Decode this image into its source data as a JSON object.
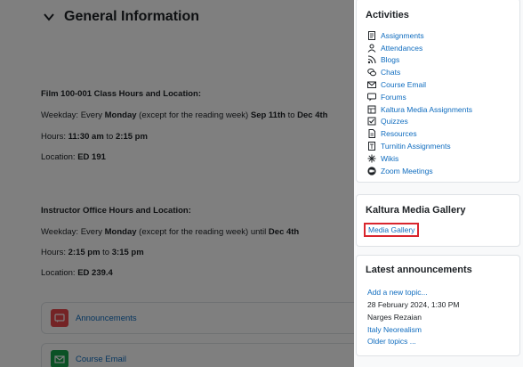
{
  "section": {
    "title": "General Information"
  },
  "class_info": {
    "heading": "Film 100-001 Class Hours and Location:",
    "weekday_prefix": "Weekday: Every",
    "weekday_day": "Monday",
    "weekday_mid": "(except for the reading week)",
    "weekday_start": "Sep 11th",
    "weekday_to": "to",
    "weekday_end": "Dec 4th",
    "hours_prefix": "Hours:",
    "hours_start": "11:30 am",
    "hours_to": "to",
    "hours_end": "2:15 pm",
    "location_prefix": "Location:",
    "location_value": "ED 191"
  },
  "office_info": {
    "heading": "Instructor Office Hours and Location:",
    "weekday_prefix": "Weekday: Every",
    "weekday_day": "Monday",
    "weekday_mid": "(except for the reading week) until",
    "weekday_end": "Dec 4th",
    "hours_prefix": "Hours:",
    "hours_start": "2:15 pm",
    "hours_to": "to",
    "hours_end": "3:15 pm",
    "location_prefix": "Location:",
    "location_value": "ED 239.4"
  },
  "course_activities": [
    {
      "label": "Announcements",
      "icon": "announcement-icon",
      "color": "#e8474a"
    },
    {
      "label": "Course Email",
      "icon": "email-icon",
      "color": "#16a34a"
    }
  ],
  "activities_block": {
    "title": "Activities",
    "items": [
      {
        "label": "Assignments",
        "icon": "assignment-icon"
      },
      {
        "label": "Attendances",
        "icon": "attendance-icon"
      },
      {
        "label": "Blogs",
        "icon": "blog-icon"
      },
      {
        "label": "Chats",
        "icon": "chat-icon"
      },
      {
        "label": "Course Email",
        "icon": "email-icon"
      },
      {
        "label": "Forums",
        "icon": "forum-icon"
      },
      {
        "label": "Kaltura Media Assignments",
        "icon": "kaltura-icon"
      },
      {
        "label": "Quizzes",
        "icon": "quiz-icon"
      },
      {
        "label": "Resources",
        "icon": "resource-icon"
      },
      {
        "label": "Turnitin Assignments",
        "icon": "turnitin-icon"
      },
      {
        "label": "Wikis",
        "icon": "wiki-icon"
      },
      {
        "label": "Zoom Meetings",
        "icon": "zoom-icon"
      }
    ]
  },
  "kaltura_block": {
    "title": "Kaltura Media Gallery",
    "link": "Media Gallery",
    "highlight_color": "#d9262e"
  },
  "announcements_block": {
    "title": "Latest announcements",
    "add_topic": "Add a new topic...",
    "date": "28 February 2024, 1:30 PM",
    "author": "Narges Rezaian",
    "topic": "Italy Neorealism",
    "older": "Older topics ..."
  },
  "colors": {
    "link": "#0f6cbf",
    "text": "#1d2125",
    "overlay": "rgba(0,0,0,0.5)"
  }
}
